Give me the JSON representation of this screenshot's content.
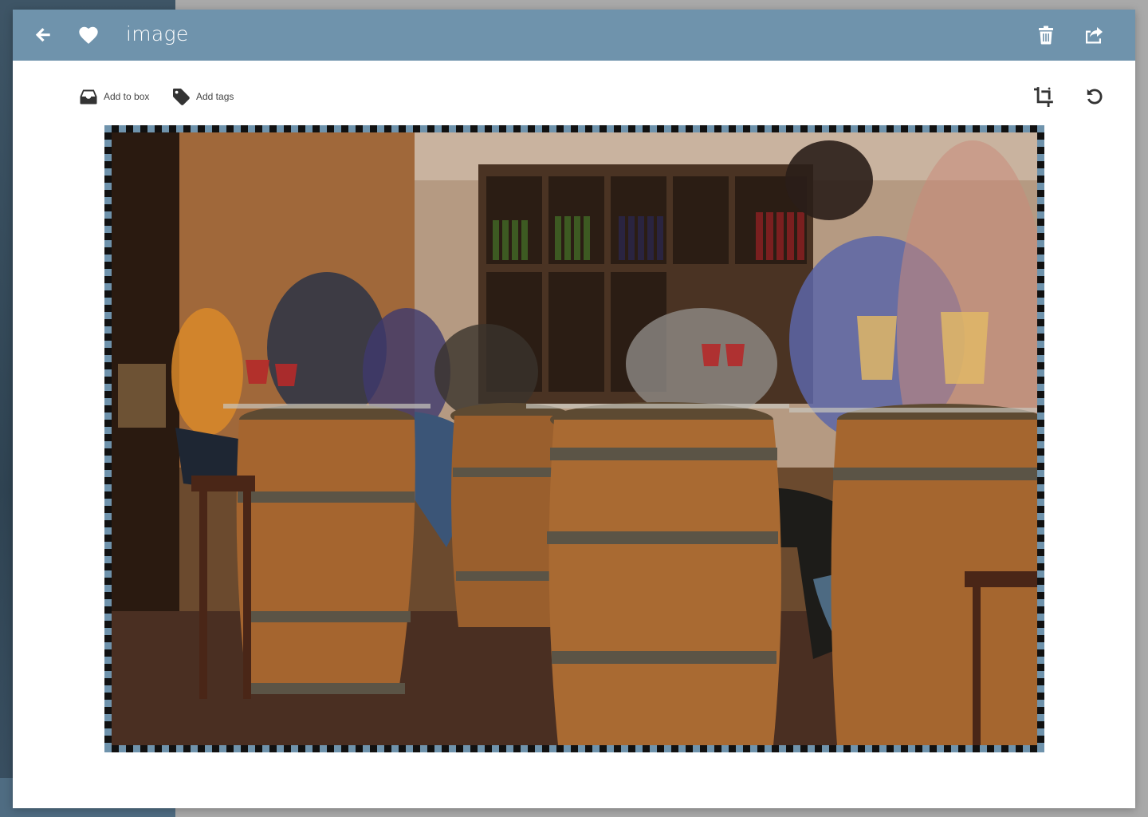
{
  "header": {
    "title": "image",
    "back_icon": "arrow-left-icon",
    "favorite_icon": "heart-icon",
    "delete_icon": "trash-icon",
    "share_icon": "share-icon"
  },
  "toolbar": {
    "add_to_box_label": "Add to box",
    "add_tags_label": "Add tags",
    "add_to_box_icon": "inbox-icon",
    "add_tags_icon": "tag-icon",
    "crop_icon": "crop-icon",
    "rotate_icon": "rotate-icon"
  },
  "colors": {
    "header_bg": "#6f93ac",
    "modal_bg": "#ffffff",
    "backdrop": "#a9a9a9",
    "sidebar": "#3e5566"
  }
}
